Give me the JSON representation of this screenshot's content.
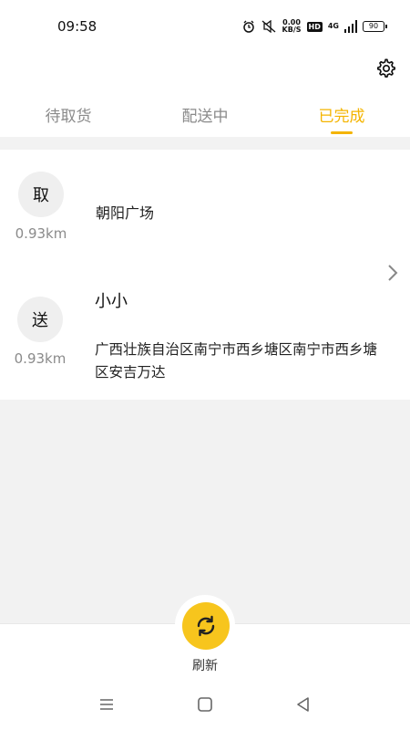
{
  "status_bar": {
    "time": "09:58",
    "net_speed_value": "0.00",
    "net_speed_unit": "KB/S",
    "hd_label": "HD",
    "network_type": "4G",
    "battery": "90",
    "icons": [
      "alarm-icon",
      "mute-icon",
      "signal-icon",
      "battery-icon"
    ]
  },
  "header": {
    "settings_icon": "gear-icon",
    "tabs": [
      {
        "label": "待取货"
      },
      {
        "label": "配送中"
      },
      {
        "label": "已完成"
      }
    ],
    "active_tab": 2,
    "accent_color": "#f4b400"
  },
  "order": {
    "pickup": {
      "badge": "取",
      "distance": "0.93km",
      "name": "朝阳广场"
    },
    "delivery": {
      "badge": "送",
      "distance": "0.93km",
      "recipient": "小小",
      "address": "广西壮族自治区南宁市西乡塘区南宁市西乡塘区安吉万达"
    }
  },
  "bottom": {
    "refresh_label": "刷新",
    "refresh_color": "#f7c51d"
  },
  "nav_bar": {
    "icons": [
      "menu-icon",
      "home-icon",
      "back-icon"
    ]
  }
}
